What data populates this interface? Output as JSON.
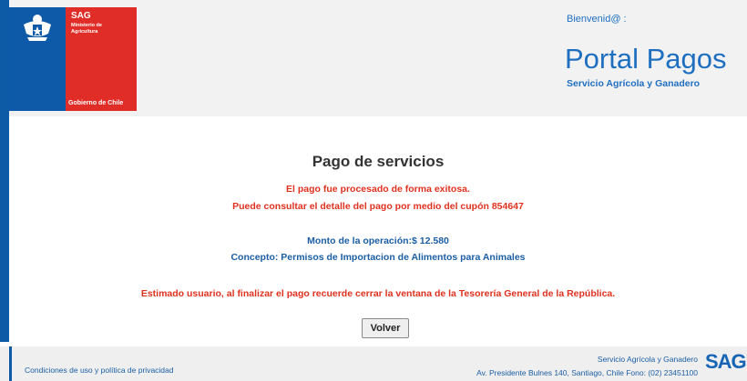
{
  "header": {
    "logo": {
      "brand": "SAG",
      "ministry_line1": "Ministerio de",
      "ministry_line2": "Agricultura",
      "government": "Gobierno de Chile"
    },
    "welcome": "Bienvenid@ :",
    "portal_title": "Portal Pagos",
    "portal_subtitle": "Servicio Agrícola y Ganadero"
  },
  "main": {
    "title": "Pago de servicios",
    "success_message": "El pago fue procesado de forma exitosa.",
    "coupon_message": "Puede consultar el detalle del pago por medio del cupón 854647",
    "amount": "Monto de la operación:$ 12.580",
    "concept": "Concepto: Permisos de Importacion de Alimentos para Animales",
    "reminder": "Estimado usuario, al finalizar el pago recuerde cerrar la ventana de la Tesorería General de la República.",
    "back_button": "Volver"
  },
  "footer": {
    "privacy_link": "Condiciones de uso y política de privacidad",
    "org_name": "Servicio Agrícola y Ganadero",
    "address": "Av. Presidente Bulnes 140, Santiago, Chile Fono: (02) 23451100",
    "logo": "SAG"
  },
  "colors": {
    "brand_blue": "#1f6fc0",
    "gov_red": "#e12d27",
    "gov_blue": "#0f5aa8",
    "alert_red": "#e0311f"
  }
}
